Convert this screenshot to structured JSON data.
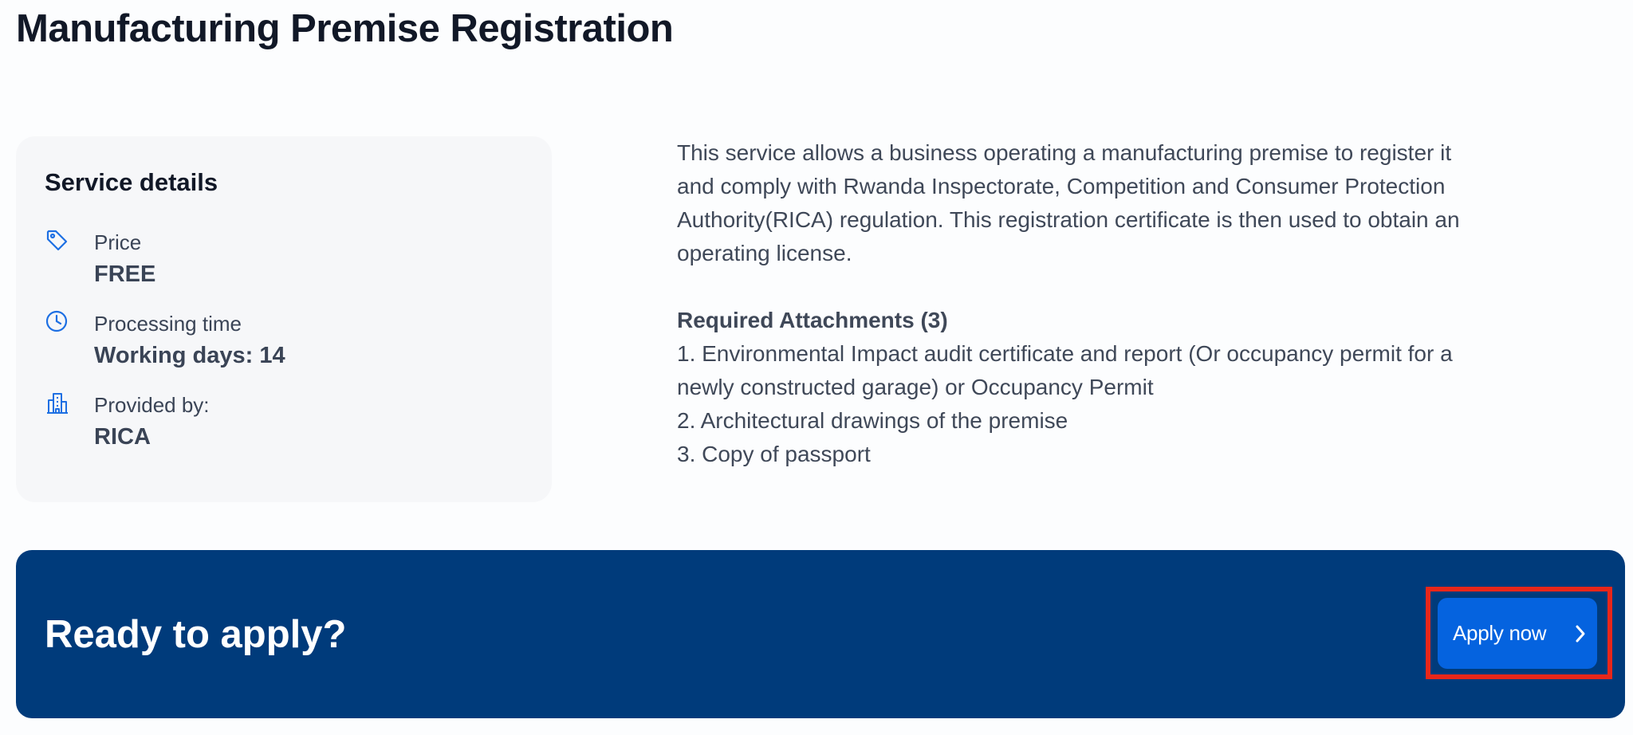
{
  "page": {
    "title": "Manufacturing Premise Registration"
  },
  "service_details": {
    "heading": "Service details",
    "items": [
      {
        "icon": "price-tag-icon",
        "label": "Price",
        "value": "FREE"
      },
      {
        "icon": "clock-icon",
        "label": "Processing time",
        "value": "Working days: 14"
      },
      {
        "icon": "building-icon",
        "label": "Provided by:",
        "value": "RICA"
      }
    ]
  },
  "description": {
    "line1": "This service allows a business operating a manufacturing premise to register it",
    "line2": "and comply with Rwanda Inspectorate, Competition and Consumer Protection",
    "line3": "Authority(RICA) regulation. This registration certificate is then used to obtain an",
    "line4": "operating license."
  },
  "attachments": {
    "heading": "Required Attachments (3)",
    "items": [
      "1. Environmental Impact audit certificate and report (Or occupancy permit for a",
      "newly constructed garage) or Occupancy Permit",
      "2. Architectural drawings of the premise",
      "3. Copy of passport"
    ]
  },
  "cta": {
    "title": "Ready to apply?",
    "button_label": "Apply now",
    "button_icon": "chevron-right-icon"
  },
  "colors": {
    "accent": "#0563df",
    "banner": "#003b7b",
    "highlight": "#e8271a",
    "card": "#f6f7f9"
  }
}
